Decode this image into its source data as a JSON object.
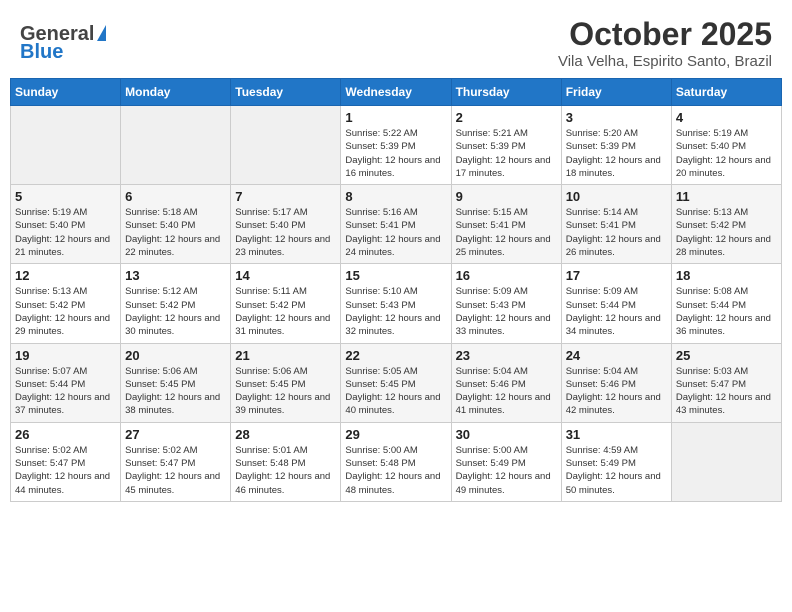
{
  "logo": {
    "general": "General",
    "blue": "Blue"
  },
  "header": {
    "month": "October 2025",
    "location": "Vila Velha, Espirito Santo, Brazil"
  },
  "days_of_week": [
    "Sunday",
    "Monday",
    "Tuesday",
    "Wednesday",
    "Thursday",
    "Friday",
    "Saturday"
  ],
  "weeks": [
    [
      {
        "day": "",
        "info": ""
      },
      {
        "day": "",
        "info": ""
      },
      {
        "day": "",
        "info": ""
      },
      {
        "day": "1",
        "info": "Sunrise: 5:22 AM\nSunset: 5:39 PM\nDaylight: 12 hours and 16 minutes."
      },
      {
        "day": "2",
        "info": "Sunrise: 5:21 AM\nSunset: 5:39 PM\nDaylight: 12 hours and 17 minutes."
      },
      {
        "day": "3",
        "info": "Sunrise: 5:20 AM\nSunset: 5:39 PM\nDaylight: 12 hours and 18 minutes."
      },
      {
        "day": "4",
        "info": "Sunrise: 5:19 AM\nSunset: 5:40 PM\nDaylight: 12 hours and 20 minutes."
      }
    ],
    [
      {
        "day": "5",
        "info": "Sunrise: 5:19 AM\nSunset: 5:40 PM\nDaylight: 12 hours and 21 minutes."
      },
      {
        "day": "6",
        "info": "Sunrise: 5:18 AM\nSunset: 5:40 PM\nDaylight: 12 hours and 22 minutes."
      },
      {
        "day": "7",
        "info": "Sunrise: 5:17 AM\nSunset: 5:40 PM\nDaylight: 12 hours and 23 minutes."
      },
      {
        "day": "8",
        "info": "Sunrise: 5:16 AM\nSunset: 5:41 PM\nDaylight: 12 hours and 24 minutes."
      },
      {
        "day": "9",
        "info": "Sunrise: 5:15 AM\nSunset: 5:41 PM\nDaylight: 12 hours and 25 minutes."
      },
      {
        "day": "10",
        "info": "Sunrise: 5:14 AM\nSunset: 5:41 PM\nDaylight: 12 hours and 26 minutes."
      },
      {
        "day": "11",
        "info": "Sunrise: 5:13 AM\nSunset: 5:42 PM\nDaylight: 12 hours and 28 minutes."
      }
    ],
    [
      {
        "day": "12",
        "info": "Sunrise: 5:13 AM\nSunset: 5:42 PM\nDaylight: 12 hours and 29 minutes."
      },
      {
        "day": "13",
        "info": "Sunrise: 5:12 AM\nSunset: 5:42 PM\nDaylight: 12 hours and 30 minutes."
      },
      {
        "day": "14",
        "info": "Sunrise: 5:11 AM\nSunset: 5:42 PM\nDaylight: 12 hours and 31 minutes."
      },
      {
        "day": "15",
        "info": "Sunrise: 5:10 AM\nSunset: 5:43 PM\nDaylight: 12 hours and 32 minutes."
      },
      {
        "day": "16",
        "info": "Sunrise: 5:09 AM\nSunset: 5:43 PM\nDaylight: 12 hours and 33 minutes."
      },
      {
        "day": "17",
        "info": "Sunrise: 5:09 AM\nSunset: 5:44 PM\nDaylight: 12 hours and 34 minutes."
      },
      {
        "day": "18",
        "info": "Sunrise: 5:08 AM\nSunset: 5:44 PM\nDaylight: 12 hours and 36 minutes."
      }
    ],
    [
      {
        "day": "19",
        "info": "Sunrise: 5:07 AM\nSunset: 5:44 PM\nDaylight: 12 hours and 37 minutes."
      },
      {
        "day": "20",
        "info": "Sunrise: 5:06 AM\nSunset: 5:45 PM\nDaylight: 12 hours and 38 minutes."
      },
      {
        "day": "21",
        "info": "Sunrise: 5:06 AM\nSunset: 5:45 PM\nDaylight: 12 hours and 39 minutes."
      },
      {
        "day": "22",
        "info": "Sunrise: 5:05 AM\nSunset: 5:45 PM\nDaylight: 12 hours and 40 minutes."
      },
      {
        "day": "23",
        "info": "Sunrise: 5:04 AM\nSunset: 5:46 PM\nDaylight: 12 hours and 41 minutes."
      },
      {
        "day": "24",
        "info": "Sunrise: 5:04 AM\nSunset: 5:46 PM\nDaylight: 12 hours and 42 minutes."
      },
      {
        "day": "25",
        "info": "Sunrise: 5:03 AM\nSunset: 5:47 PM\nDaylight: 12 hours and 43 minutes."
      }
    ],
    [
      {
        "day": "26",
        "info": "Sunrise: 5:02 AM\nSunset: 5:47 PM\nDaylight: 12 hours and 44 minutes."
      },
      {
        "day": "27",
        "info": "Sunrise: 5:02 AM\nSunset: 5:47 PM\nDaylight: 12 hours and 45 minutes."
      },
      {
        "day": "28",
        "info": "Sunrise: 5:01 AM\nSunset: 5:48 PM\nDaylight: 12 hours and 46 minutes."
      },
      {
        "day": "29",
        "info": "Sunrise: 5:00 AM\nSunset: 5:48 PM\nDaylight: 12 hours and 48 minutes."
      },
      {
        "day": "30",
        "info": "Sunrise: 5:00 AM\nSunset: 5:49 PM\nDaylight: 12 hours and 49 minutes."
      },
      {
        "day": "31",
        "info": "Sunrise: 4:59 AM\nSunset: 5:49 PM\nDaylight: 12 hours and 50 minutes."
      },
      {
        "day": "",
        "info": ""
      }
    ]
  ]
}
